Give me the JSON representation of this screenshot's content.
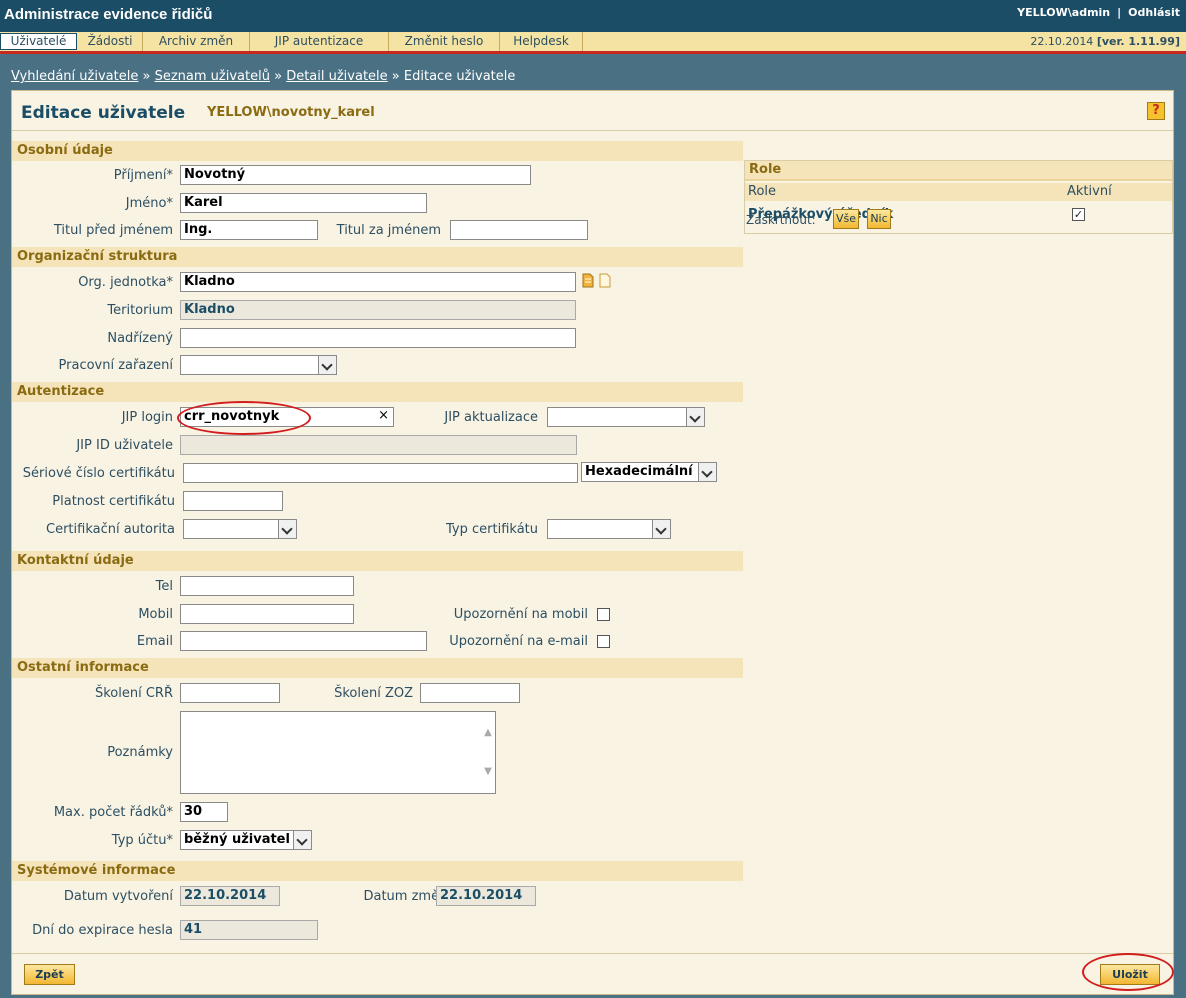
{
  "header": {
    "app_title": "Administrace evidence řidičů",
    "user": "YELLOW\\admin",
    "separator": "|",
    "logout": "Odhlásit"
  },
  "menu": {
    "items": [
      "Uživatelé",
      "Žádosti",
      "Archiv změn",
      "JIP autentizace",
      "Změnit heslo",
      "Helpdesk"
    ],
    "active": "Uživatelé",
    "date": "22.10.2014",
    "version": "[ver. 1.11.99]"
  },
  "breadcrumb": {
    "items": [
      "Vyhledání uživatele",
      "Seznam uživatelů",
      "Detail uživatele"
    ],
    "separator": "»",
    "current": "Editace uživatele"
  },
  "page": {
    "title": "Editace uživatele",
    "username": "YELLOW\\novotny_karel",
    "help": "?"
  },
  "sections": {
    "personal": "Osobní údaje",
    "org": "Organizační struktura",
    "auth": "Autentizace",
    "contact": "Kontaktní údaje",
    "other": "Ostatní informace",
    "system": "Systémové informace"
  },
  "personal": {
    "surname_label": "Příjmení*",
    "surname": "Novotný",
    "name_label": "Jméno*",
    "name": "Karel",
    "title_before_label": "Titul před jménem",
    "title_before": "Ing.",
    "title_after_label": "Titul za jménem",
    "title_after": ""
  },
  "org": {
    "unit_label": "Org. jednotka*",
    "unit": "Kladno",
    "territory_label": "Teritorium",
    "territory": "Kladno",
    "superior_label": "Nadřízený",
    "superior": "",
    "position_label": "Pracovní zařazení",
    "position": ""
  },
  "auth": {
    "jip_login_label": "JIP login",
    "jip_login": "crr_novotnyk",
    "clear": "×",
    "jip_update_label": "JIP aktualizace",
    "jip_update": "",
    "jip_id_label": "JIP ID uživatele",
    "jip_id": "",
    "cert_serial_label": "Sériové číslo certifikátu",
    "cert_serial": "",
    "cert_format": "Hexadecimální",
    "cert_validity_label": "Platnost certifikátu",
    "cert_validity": "",
    "cert_authority_label": "Certifikační autorita",
    "cert_authority": "",
    "cert_type_label": "Typ certifikátu",
    "cert_type": ""
  },
  "contact": {
    "tel_label": "Tel",
    "tel": "",
    "mobile_label": "Mobil",
    "mobile": "",
    "email_label": "Email",
    "email": "",
    "notify_mobile_label": "Upozornění na mobil",
    "notify_email_label": "Upozornění na e-mail"
  },
  "other": {
    "training_crr_label": "Školení CRŘ",
    "training_crr": "",
    "training_zoz_label": "Školení ZOZ",
    "training_zoz": "",
    "notes_label": "Poznámky",
    "max_rows_label": "Max. počet řádků*",
    "max_rows": "30",
    "account_type_label": "Typ účtu*",
    "account_type": "běžný uživatel"
  },
  "system": {
    "created_label": "Datum vytvoření",
    "created": "22.10.2014",
    "changed_label": "Datum změny",
    "changed": "22.10.2014",
    "expiry_label": "Dní do expirace hesla",
    "expiry": "41"
  },
  "roles": {
    "section": "Role",
    "col_role": "Role",
    "col_active": "Aktivní",
    "rows": [
      {
        "name": "Přepážkový úředník",
        "active": true
      }
    ],
    "check_label": "Zaškrtnout:",
    "all": "Vše",
    "none": "Nic"
  },
  "buttons": {
    "back": "Zpět",
    "save": "Uložit"
  },
  "colors": {
    "header_bg": "#1b4e66",
    "menu_bg": "#f5e3a4",
    "accent_red": "#c8291e",
    "section_bg": "#f5e3b9",
    "annotation_red": "#d11d1d"
  }
}
